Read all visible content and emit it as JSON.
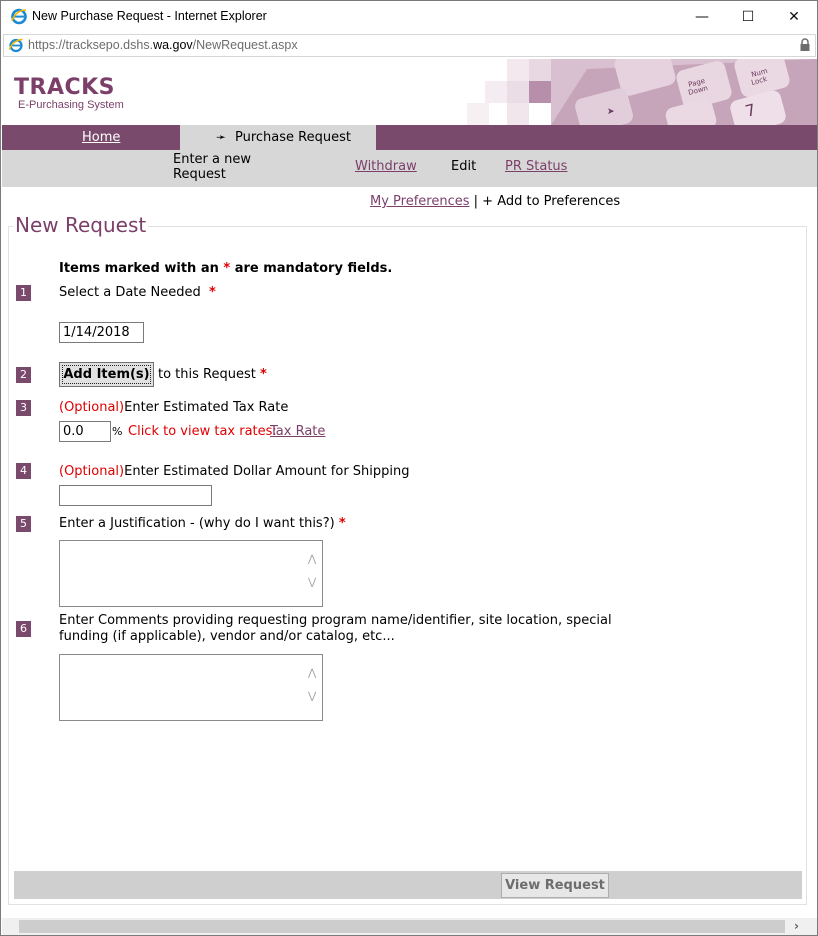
{
  "window": {
    "title": "New Purchase Request - Internet Explorer",
    "controls": {
      "minimize": "—",
      "maximize": "☐",
      "close": "✕"
    }
  },
  "address": {
    "scheme": "https://tracksepo.dshs.",
    "host": "wa.gov",
    "path": "/NewRequest.aspx"
  },
  "brand": {
    "logo": "TRACKS",
    "tagline": "E-Purchasing System"
  },
  "nav": {
    "home": "Home",
    "active_arrow": "➛",
    "active": "Purchase Request"
  },
  "subnav": {
    "enter_new_line1": "Enter a new",
    "enter_new_line2": "Request",
    "withdraw": "Withdraw",
    "edit": "Edit",
    "pr_status": "PR Status"
  },
  "prefs": {
    "my_preferences": "My Preferences",
    "separator": "|",
    "add": "+ Add to Preferences"
  },
  "form": {
    "legend": "New Request",
    "mandatory_note_pre": "Items marked with an ",
    "asterisk": "*",
    "mandatory_note_post": " are mandatory fields.",
    "step1": {
      "num": "1",
      "label": "Select a Date Needed",
      "value": "1/14/2018"
    },
    "step2": {
      "num": "2",
      "button": "Add Item(s)",
      "label": "to this Request"
    },
    "step3": {
      "num": "3",
      "optional": "(Optional)",
      "label": "Enter Estimated Tax Rate",
      "value": "0.0",
      "percent": "%",
      "click_text": "Click to view tax rates:",
      "link": "Tax Rate"
    },
    "step4": {
      "num": "4",
      "optional": "(Optional)",
      "label": "Enter Estimated Dollar Amount for Shipping",
      "value": ""
    },
    "step5": {
      "num": "5",
      "label": "Enter a Justification - (why do I want this?)"
    },
    "step6": {
      "num": "6",
      "label_line1": "Enter Comments providing requesting program name/identifier, site location, special",
      "label_line2": "funding (if applicable), vendor and/or catalog, etc..."
    },
    "view_button": "View Request"
  },
  "scroll": {
    "left": "‹",
    "right": "›"
  },
  "colors": {
    "brand": "#7b3f6a",
    "nav": "#7a4a6c",
    "required": "#e00000",
    "subnav": "#d7d7d7"
  }
}
